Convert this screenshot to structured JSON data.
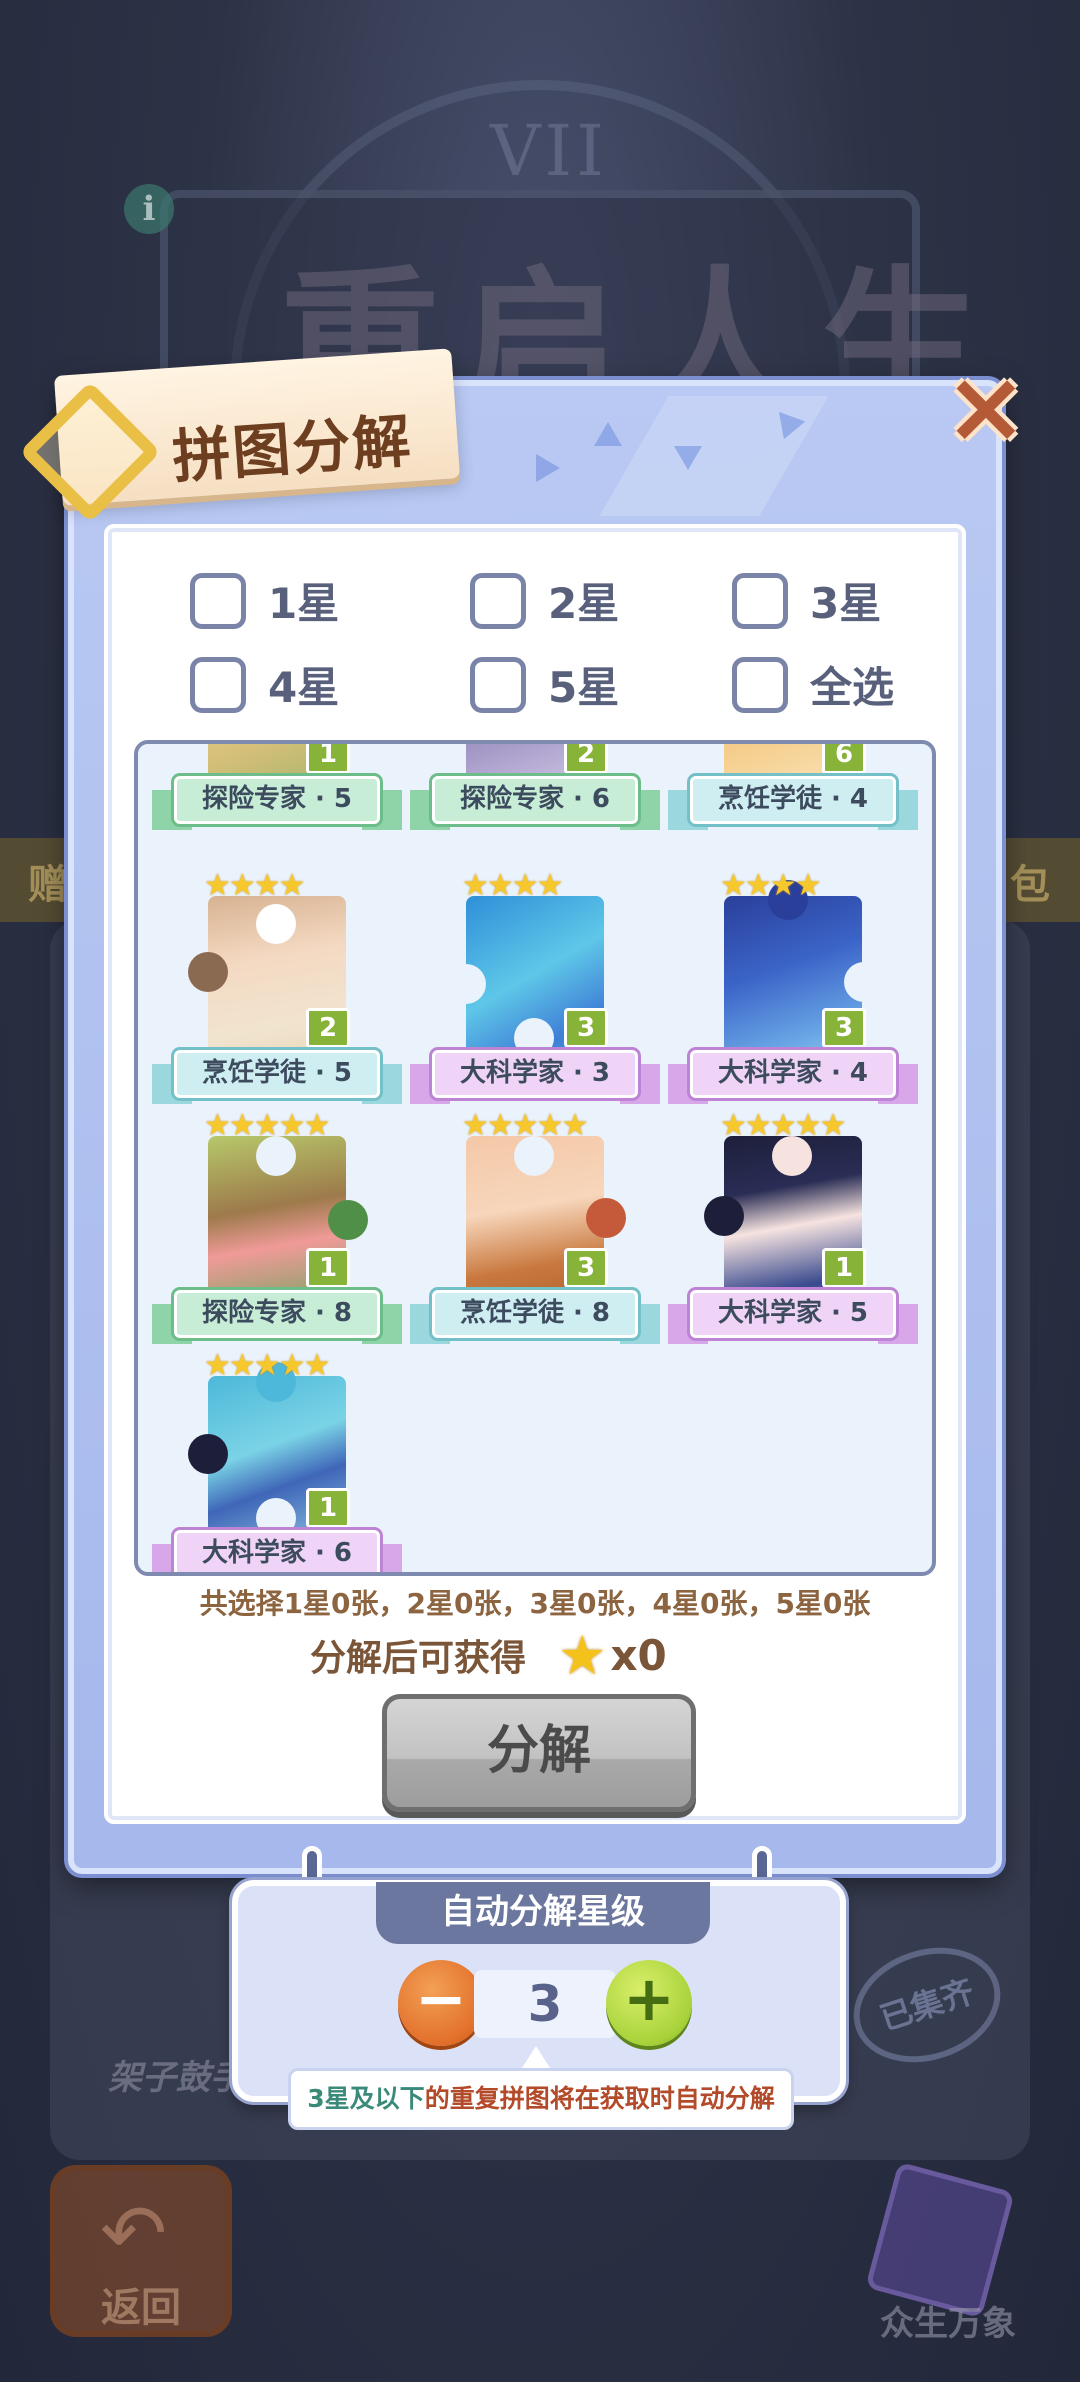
{
  "background": {
    "game_title": "重启人生",
    "clock_numeral": "VII",
    "info_icon": "i",
    "strip_left": "赠",
    "strip_right": "包",
    "card_label": "架子鼓手",
    "collected_stamp": "已集齐",
    "back_label": "返回",
    "gallery_label": "众生万象"
  },
  "dialog": {
    "title": "拼图分解",
    "close_icon": "close-icon"
  },
  "filters": [
    {
      "label": "1星",
      "checked": false
    },
    {
      "label": "2星",
      "checked": false
    },
    {
      "label": "3星",
      "checked": false
    },
    {
      "label": "4星",
      "checked": false
    },
    {
      "label": "5星",
      "checked": false
    },
    {
      "label": "全选",
      "checked": false
    }
  ],
  "pieces": [
    {
      "name": "探险专家 · 5",
      "stars": "",
      "count": "1",
      "theme": "green"
    },
    {
      "name": "探险专家 · 6",
      "stars": "",
      "count": "2",
      "theme": "green"
    },
    {
      "name": "烹饪学徒 · 4",
      "stars": "",
      "count": "6",
      "theme": "teal"
    },
    {
      "name": "烹饪学徒 · 5",
      "stars": "★★★★",
      "count": "2",
      "theme": "teal"
    },
    {
      "name": "大科学家 · 3",
      "stars": "★★★★",
      "count": "3",
      "theme": "purple"
    },
    {
      "name": "大科学家 · 4",
      "stars": "★★★★",
      "count": "3",
      "theme": "purple"
    },
    {
      "name": "探险专家 · 8",
      "stars": "★★★★★",
      "count": "1",
      "theme": "green"
    },
    {
      "name": "烹饪学徒 · 8",
      "stars": "★★★★★",
      "count": "3",
      "theme": "teal"
    },
    {
      "name": "大科学家 · 5",
      "stars": "★★★★★",
      "count": "1",
      "theme": "purple"
    },
    {
      "name": "大科学家 · 6",
      "stars": "★★★★★",
      "count": "1",
      "theme": "purple"
    }
  ],
  "summary": "共选择1星0张，2星0张，3星0张，4星0张，5星0张",
  "reward": {
    "label": "分解后可获得",
    "icon": "star-icon",
    "count": "x0"
  },
  "decompose_button": "分解",
  "auto_decompose": {
    "title": "自动分解星级",
    "value": "3",
    "minus_icon": "minus-icon",
    "plus_icon": "plus-icon",
    "tip_highlight": "3星及以下",
    "tip_text": "的重复拼图将在获取时自动分解"
  },
  "colors": {
    "dialog_bg": "#b9c9f3",
    "title_text": "#6d3e1f",
    "star_gold": "#f7c82c",
    "count_badge": "#87b338",
    "decompose_button": "#c2c2c2",
    "minus_button": "#e2702b",
    "plus_button": "#a8d23a"
  }
}
